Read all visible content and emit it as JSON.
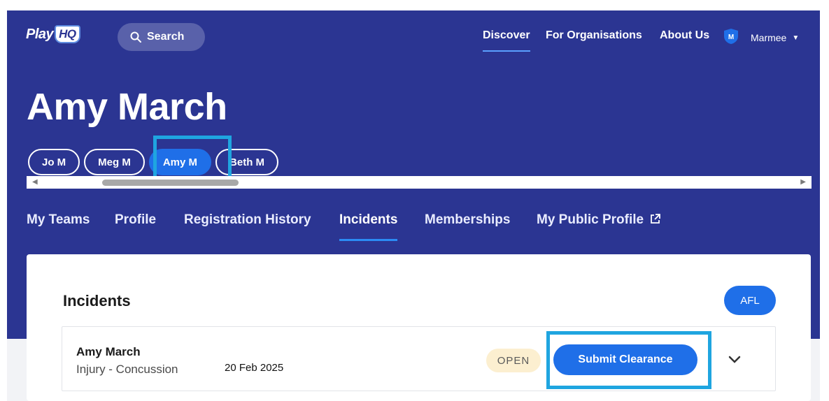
{
  "brand": {
    "logo_text": "Play",
    "logo_mark": "HQ"
  },
  "search": {
    "label": "Search",
    "icon": "search-icon"
  },
  "topnav": {
    "links": [
      "Discover",
      "For Organisations",
      "About Us"
    ],
    "user_initial": "M",
    "user_name": "Marmee"
  },
  "profile": {
    "name": "Amy March",
    "chips": [
      "Jo M",
      "Meg M",
      "Amy M",
      "Beth M"
    ]
  },
  "tabs": [
    "My Teams",
    "Profile",
    "Registration History",
    "Incidents",
    "Memberships",
    "My Public Profile"
  ],
  "incidents": {
    "title": "Incidents",
    "org_badge": "AFL",
    "items": [
      {
        "name": "Amy March",
        "type": "Injury - Concussion",
        "date": "20 Feb 2025",
        "status": "OPEN",
        "action": "Submit Clearance"
      }
    ]
  },
  "colors": {
    "hero": "#2b3592",
    "accent": "#1f6fe8",
    "highlight": "#1fa5e0",
    "open_badge": "#fcefd0"
  }
}
